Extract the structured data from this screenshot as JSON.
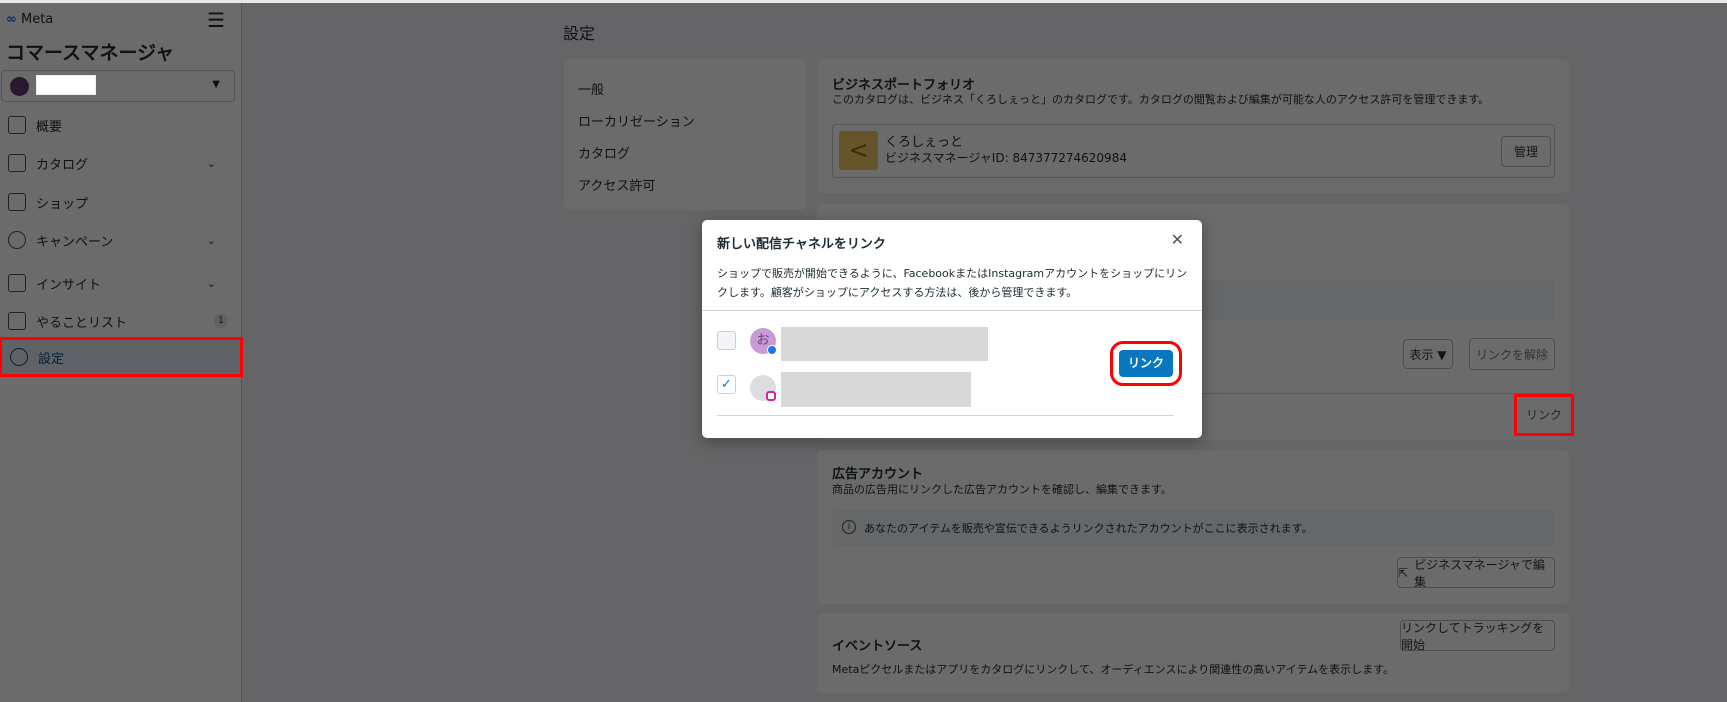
{
  "sidebar": {
    "brand": "Meta",
    "app_title": "コマースマネージャ",
    "nav": [
      {
        "label": "概要"
      },
      {
        "label": "カタログ"
      },
      {
        "label": "ショップ"
      },
      {
        "label": "キャンペーン"
      },
      {
        "label": "インサイト"
      },
      {
        "label": "やることリスト",
        "badge": "1"
      },
      {
        "label": "設定"
      }
    ]
  },
  "main": {
    "page_title": "設定",
    "settings_nav": [
      "一般",
      "ローカリゼーション",
      "カタログ",
      "アクセス許可"
    ],
    "portfolio": {
      "title": "ビジネスポートフォリオ",
      "desc": "このカタログは、ビジネス「くろしぇっと」のカタログです。カタログの閲覧および編集が可能な人のアクセス許可を管理できます。",
      "business_name": "くろしぇっと",
      "business_id": "ビジネスマネージャID: 847377274620984",
      "manage": "管理"
    },
    "channels": {
      "show": "表示 ▼",
      "unlink": "リンクを解除",
      "link": "リンク"
    },
    "ad_accounts": {
      "title": "広告アカウント",
      "desc": "商品の広告用にリンクした広告アカウントを確認し、編集できます。",
      "info": "あなたのアイテムを販売や宣伝できるようリンクされたアカウントがここに表示されます。",
      "edit": "ビジネスマネージャで編集"
    },
    "event_source": {
      "title": "イベントソース",
      "desc": "Metaピクセルまたはアプリをカタログにリンクして、オーディエンスにより関連性の高いアイテムを表示します。",
      "button": "リンクしてトラッキングを開始"
    }
  },
  "modal": {
    "title": "新しい配信チャネルをリンク",
    "desc": "ショップで販売が開始できるように、FacebookまたはInstagramアカウントをショップにリンクします。顧客がショップにアクセスする方法は、後から管理できます。",
    "avatar_letter": "お",
    "accounts": [
      {
        "checked": false,
        "platform": "facebook"
      },
      {
        "checked": true,
        "platform": "instagram"
      }
    ],
    "link_button": "リンク"
  },
  "colors": {
    "primary": "#0a78be",
    "highlight": "#ff0000"
  }
}
